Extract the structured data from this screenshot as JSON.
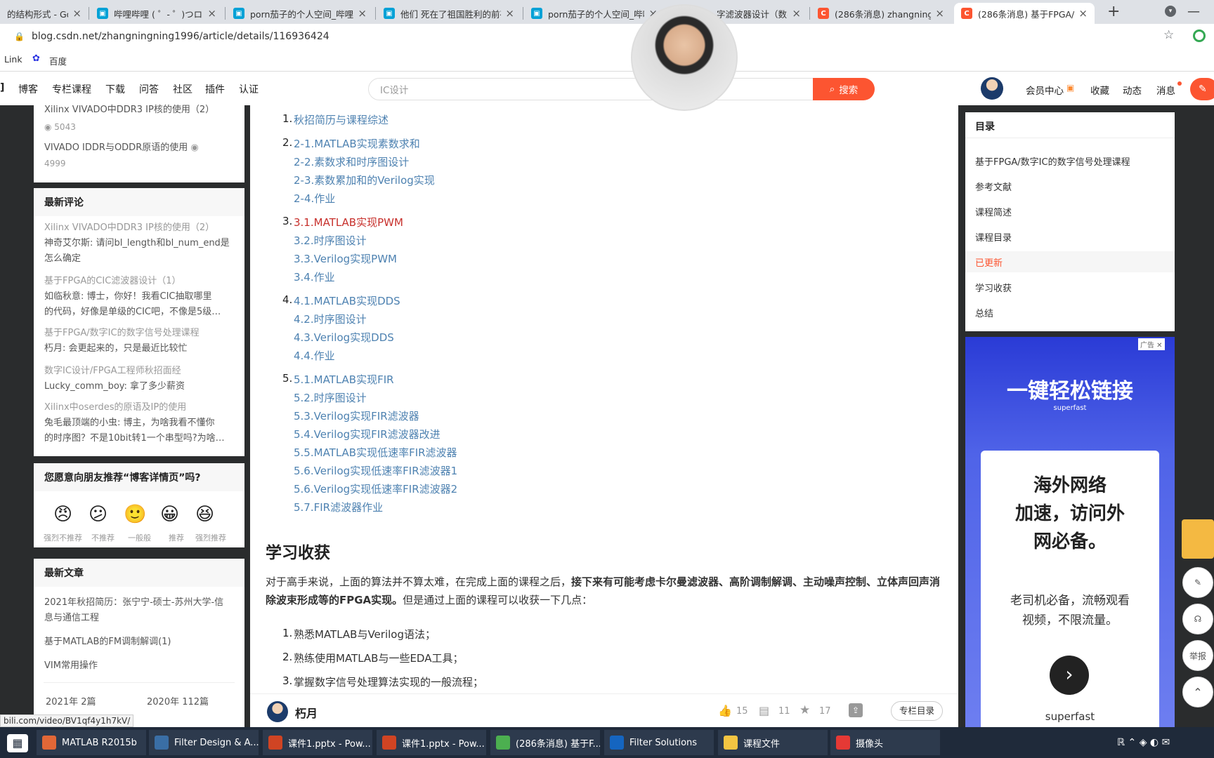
{
  "browser": {
    "tabs": [
      {
        "title": "的结构形式 - Go",
        "fav": "",
        "color": "#4285f4"
      },
      {
        "title": "哔哩哔哩 ( ゜- ゜)つロ 干杯",
        "fav": "",
        "color": "#00a1d6"
      },
      {
        "title": "porn茄子的个人空间_哔哩",
        "fav": "",
        "color": "#00a1d6"
      },
      {
        "title": "他们 死在了祖国胜利的前夜",
        "fav": "",
        "color": "#00a1d6"
      },
      {
        "title": "porn茄子的个人空间_哔哩",
        "fav": "",
        "color": "#00a1d6"
      },
      {
        "title": "字滤波器设计（数字信",
        "fav": "",
        "color": "#00a1d6"
      },
      {
        "title": "(286条消息) zhangningnin",
        "fav": "C",
        "color": "#fc5531"
      },
      {
        "title": "(286条消息) 基于FPGA/数",
        "fav": "C",
        "color": "#fc5531"
      }
    ],
    "new_tab": "+",
    "url": "blog.csdn.net/zhangningning1996/article/details/116936424",
    "bookmarks": [
      "Link",
      "百度"
    ]
  },
  "nav": {
    "items": [
      "博客",
      "专栏课程",
      "下载",
      "问答",
      "社区",
      "插件",
      "认证"
    ],
    "search_placeholder": "IC设计",
    "search_button": "搜索",
    "right": [
      "会员中心",
      "收藏",
      "动态",
      "消息"
    ]
  },
  "sidebar": {
    "hot": [
      {
        "title": "Xilinx VIVADO中DDR3 IP核的使用（2）",
        "views": "5043"
      },
      {
        "title": "VIVADO IDDR与ODDR原语的使用",
        "views": "4999"
      }
    ],
    "comments_title": "最新评论",
    "comments": [
      {
        "article": "Xilinx VIVADO中DDR3 IP核的使用（2）",
        "line1": "神奇艾尔斯: 请问bl_length和bl_num_end是",
        "line2": "怎么确定"
      },
      {
        "article": "基于FPGA的CIC滤波器设计（1）",
        "line1": "如临秋意: 博士，你好！我看CIC抽取哪里",
        "line2": "的代码，好像是单级的CIC吧，不像是5级…"
      },
      {
        "article": "基于FPGA/数字IC的数字信号处理课程",
        "line1": "朽月: 会更起来的，只是最近比较忙",
        "line2": ""
      },
      {
        "article": "数字IC设计/FPGA工程师秋招面经",
        "line1": "Lucky_comm_boy: 拿了多少薪资",
        "line2": ""
      },
      {
        "article": "Xilinx中oserdes的原语及IP的使用",
        "line1": "兔毛最顶端的小虫: 博主，为啥我看不懂你",
        "line2": "的时序图？不是10bit转1一个串型吗?为啥…"
      }
    ],
    "recommend_title": "您愿意向朋友推荐“博客详情页”吗?",
    "ratings": [
      "强烈不推荐",
      "不推荐",
      "一般般",
      "推荐",
      "强烈推荐"
    ],
    "recent_title": "最新文章",
    "recent": [
      "2021年秋招简历：张宁宁-硕士-苏州大学-信",
      "息与通信工程",
      "基于MATLAB的FM调制解调(1)",
      "VIM常用操作"
    ],
    "archive": [
      "2021年  2篇",
      "2020年  112篇"
    ]
  },
  "article": {
    "items": [
      {
        "n": "1.",
        "lines": [
          "秋招简历与课程综述"
        ]
      },
      {
        "n": "2.",
        "lines": [
          "2-1.MATLAB实现素数求和",
          "2-2.素数求和时序图设计",
          "2-3.素数累加和的Verilog实现",
          "2-4.作业"
        ]
      },
      {
        "n": "3.",
        "lines": [
          "3.1.MATLAB实现PWM",
          "3.2.时序图设计",
          "3.3.Verilog实现PWM",
          "3.4.作业"
        ]
      },
      {
        "n": "4.",
        "lines": [
          "4.1.MATLAB实现DDS",
          "4.2.时序图设计",
          "4.3.Verilog实现DDS",
          "4.4.作业"
        ]
      },
      {
        "n": "5.",
        "lines": [
          "5.1.MATLAB实现FIR",
          "5.2.时序图设计",
          "5.3.Verilog实现FIR滤波器",
          "5.4.Verilog实现FIR滤波器改进",
          "5.5.MATLAB实现低速率FIR滤波器",
          "5.6.Verilog实现低速率FIR滤波器1",
          "5.6.Verilog实现低速率FIR滤波器2",
          "5.7.FIR滤波器作业"
        ]
      }
    ],
    "section_title": "学习收获",
    "para_a": "对于高手来说，上面的算法并不算太难，在完成上面的课程之后，",
    "para_b": "接下来有可能考虑卡尔曼滤波器、高阶调制解调、主动噪声控制、立体",
    "para_c": "声回声消除波束形成等的FPGA实现。",
    "para_d": "但是通过上面的课程可以收获一下几点：",
    "gains": [
      "熟悉MATLAB与Verilog语法；",
      "熟练使用MATLAB与一些EDA工具；",
      "掌握数字信号处理算法实现的一般流程；"
    ]
  },
  "bottom": {
    "author": "朽月",
    "likes": "15",
    "comments": "11",
    "stars": "17",
    "catalog": "专栏目录"
  },
  "toc": {
    "title": "目录",
    "items": [
      "基于FPGA/数字IC的数字信号处理课程",
      "参考文献",
      "课程简述",
      "课程目录",
      "已更新",
      "学习收获",
      "总结"
    ]
  },
  "ad": {
    "badge": "广告",
    "headline": "一键轻松链接",
    "brand": "superfast",
    "card_title": [
      "海外网络",
      "加速，访问外",
      "网必备。"
    ],
    "card_sub": [
      "老司机必备，流畅观看",
      "视频，不限流量。"
    ],
    "card_brand": "superfast"
  },
  "float_tools": [
    "举报"
  ],
  "status_url": "bili.com/video/BV1qf4y1h7kV/",
  "taskbar": [
    {
      "label": "MATLAB R2015b",
      "color": "#e16737"
    },
    {
      "label": "Filter Design & A...",
      "color": "#3a6ea5"
    },
    {
      "label": "课件1.pptx - Pow...",
      "color": "#d04423"
    },
    {
      "label": "课件1.pptx - Pow...",
      "color": "#d04423"
    },
    {
      "label": "(286条消息) 基于F...",
      "color": "#4caf50"
    },
    {
      "label": "Filter Solutions",
      "color": "#1565c0"
    },
    {
      "label": "课程文件",
      "color": "#f4c542"
    },
    {
      "label": "摄像头",
      "color": "#e53935"
    }
  ]
}
